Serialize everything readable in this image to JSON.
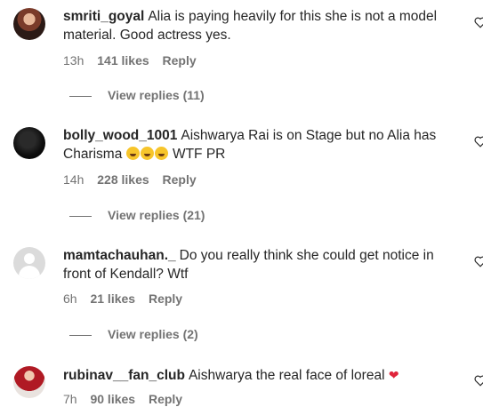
{
  "comments": [
    {
      "username": "smriti_goyal",
      "text": "Alia is paying heavily for this she is not a model material. Good actress yes.",
      "time": "13h",
      "likes": "141 likes",
      "reply": "Reply",
      "view_replies": "View replies (11)"
    },
    {
      "username": "bolly_wood_1001",
      "text_before": "Aishwarya Rai is on Stage but no Alia has Charisma",
      "text_after": "WTF PR",
      "time": "14h",
      "likes": "228 likes",
      "reply": "Reply",
      "view_replies": "View replies (21)"
    },
    {
      "username": "mamtachauhan._",
      "text": "Do you really think she could get notice in front of Kendall? Wtf",
      "time": "6h",
      "likes": "21 likes",
      "reply": "Reply",
      "view_replies": "View replies (2)"
    },
    {
      "username": "rubinav__fan_club",
      "text": "Aishwarya the real face of loreal",
      "time": "7h",
      "likes": "90 likes",
      "reply": "Reply"
    }
  ],
  "icons": {
    "like": "heart-outline-icon",
    "laugh": "tears-of-joy-emoji",
    "red_heart": "red-heart-emoji"
  },
  "colors": {
    "text": "#262626",
    "secondary": "#737373",
    "heart": "#e0243b"
  }
}
